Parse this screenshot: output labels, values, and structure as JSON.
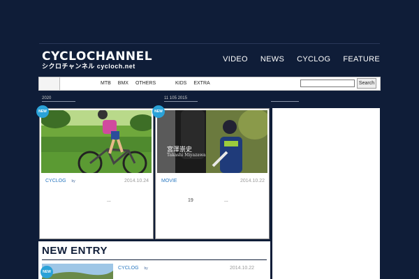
{
  "logo": {
    "line1": "CYCLOCHANNEL",
    "line2": "シクロチャンネル cycloch.net"
  },
  "main_nav": [
    "VIDEO",
    "NEWS",
    "CYCLOG",
    "FEATURE"
  ],
  "sub_nav": {
    "cats": [
      "MTB",
      "BMX",
      "OTHERS"
    ],
    "cats2": [
      "KIDS",
      "EXTRA"
    ]
  },
  "search": {
    "placeholder": "",
    "button": "Search"
  },
  "year_bar": {
    "left": "2020",
    "right": "11 105 2015"
  },
  "cards": [
    {
      "badge": "NEW",
      "category": "CYCLOG",
      "by": "by",
      "date": "2014.10.24",
      "excerpt": "..."
    },
    {
      "badge": "NEW",
      "category": "MOVIE",
      "by": "",
      "date": "2014.10.22",
      "excerpt_num": "19",
      "excerpt": "...",
      "photo_caption": "宮澤崇史",
      "photo_caption2": "Takashi Miyazawa"
    }
  ],
  "new_entry": {
    "title": "NEW ENTRY",
    "badge": "NEW",
    "category": "CYCLOG",
    "by": "by",
    "date": "2014.10.22"
  },
  "colors": {
    "background": "#0f1d38",
    "accent": "#2aa2d8",
    "link": "#2a78c0"
  }
}
